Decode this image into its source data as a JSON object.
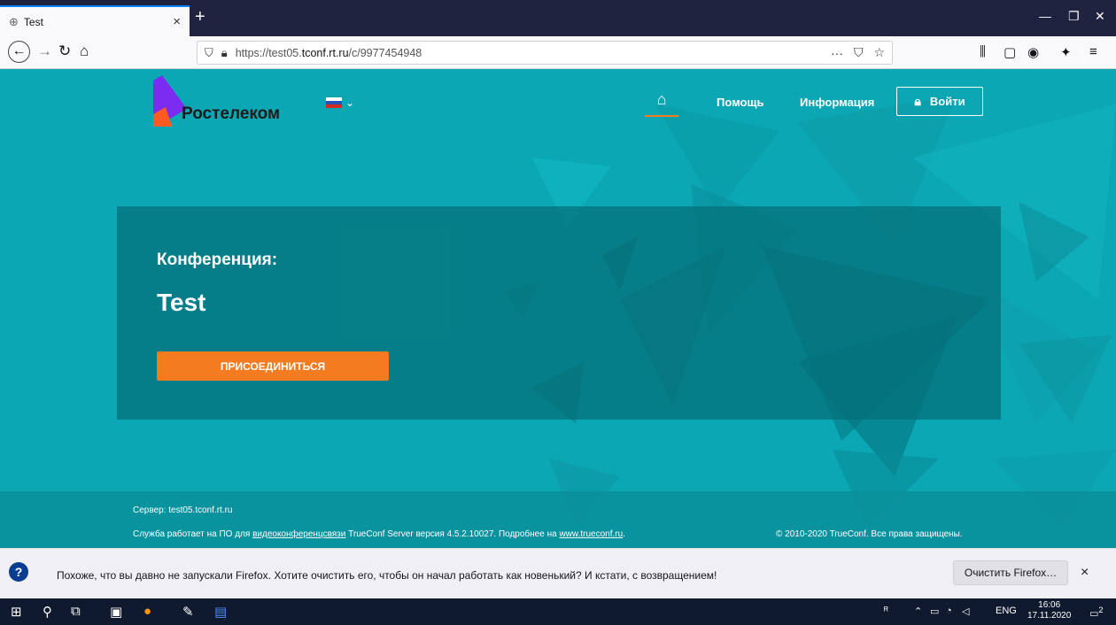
{
  "browser": {
    "tab_title": "Test",
    "tab_close": "×",
    "new_tab": "+",
    "url_prefix": "https://test05.",
    "url_host": "tconf.rt.ru",
    "url_path": "/c/9977454948",
    "url_more": "···",
    "window_minimize": "—",
    "window_restore": "❐",
    "window_close": "✕"
  },
  "site": {
    "logo_text": "Ростелеком",
    "nav": {
      "help": "Помощь",
      "info": "Информация",
      "login": "Войти"
    },
    "hero": {
      "label": "Конференция:",
      "title": "Test",
      "join_button": "ПРИСОЕДИНИТЬСЯ"
    },
    "footer": {
      "server": "Сервер: test05.tconf.rt.ru",
      "service_pre": "Служба работает на ПО для ",
      "service_link1": "видеоконференцсвязи",
      "service_mid": " TrueConf Server версия 4.5.2.10027. Подробнее на ",
      "service_link2": "www.trueconf.ru",
      "service_post": ".",
      "copyright": "© 2010-2020 TrueConf. Все права защищены."
    }
  },
  "notification": {
    "text": "Похоже, что вы давно не запускали Firefox. Хотите очистить его, чтобы он начал работать как новенький? И кстати, с возвращением!",
    "button": "Очистить Firefox…",
    "close": "×"
  },
  "taskbar": {
    "lang": "ENG",
    "time": "16:06",
    "date": "17.11.2020",
    "notif_count": "2"
  },
  "colors": {
    "page_bg": "#0ba7b4",
    "accent_orange": "#f47b20",
    "logo_purple": "#7b2cf0",
    "logo_orange": "#ff5a1f"
  }
}
